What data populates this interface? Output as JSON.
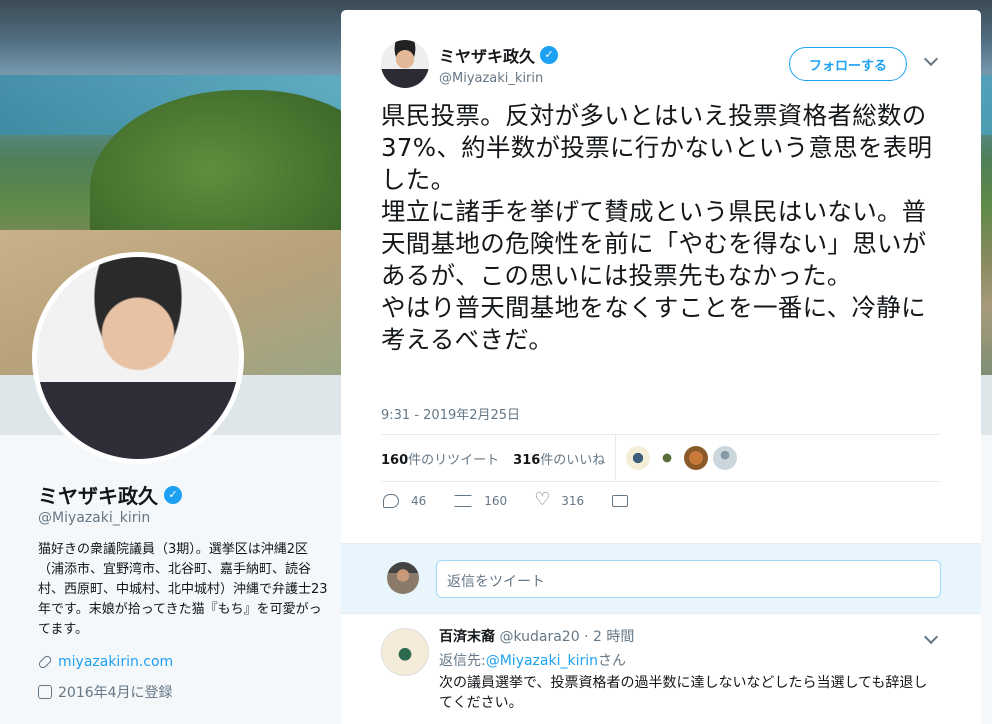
{
  "profile": {
    "name": "ミヤザキ政久",
    "handle": "@Miyazaki_kirin",
    "bio": "猫好きの衆議院議員（3期）。選挙区は沖縄2区（浦添市、宜野湾市、北谷町、嘉手納町、読谷村、西原町、中城村、北中城村）沖縄で弁護士23年です。末娘が拾ってきた猫『もち』を可愛がってます。",
    "website": "miyazakirin.com",
    "joined": "2016年4月に登録"
  },
  "tweet": {
    "author_name": "ミヤザキ政久",
    "author_handle": "@Miyazaki_kirin",
    "follow_label": "フォローする",
    "lines": [
      "県民投票。反対が多いとはいえ投票資格者総数の37%、約半数が投票に行かないという意思を表明した。",
      "埋立に諸手を挙げて賛成という県民はいない。普天間基地の危険性を前に「やむを得ない」思いがあるが、この思いには投票先もなかった。",
      "やはり普天間基地をなくすことを一番に、冷静に考えるべきだ。"
    ],
    "timestamp": "9:31 - 2019年2月25日",
    "retweet_count": "160",
    "retweet_label": "件のリツイート",
    "like_count": "316",
    "like_label": "件のいいね",
    "actions": {
      "reply": "46",
      "retweet": "160",
      "like": "316"
    }
  },
  "reply_box": {
    "placeholder": "返信をツイート"
  },
  "reply": {
    "name": "百済末裔",
    "handle": "@kudara20",
    "time": "· 2 時間",
    "to_label": "返信先:",
    "to_handle": "@Miyazaki_kirin",
    "to_suffix": "さん",
    "text": "次の議員選挙で、投票資格者の過半数に達しないなどしたら当選しても辞退してください。"
  },
  "colors": {
    "accent": "#1da1f2",
    "text": "#14171a",
    "muted": "#657786"
  }
}
